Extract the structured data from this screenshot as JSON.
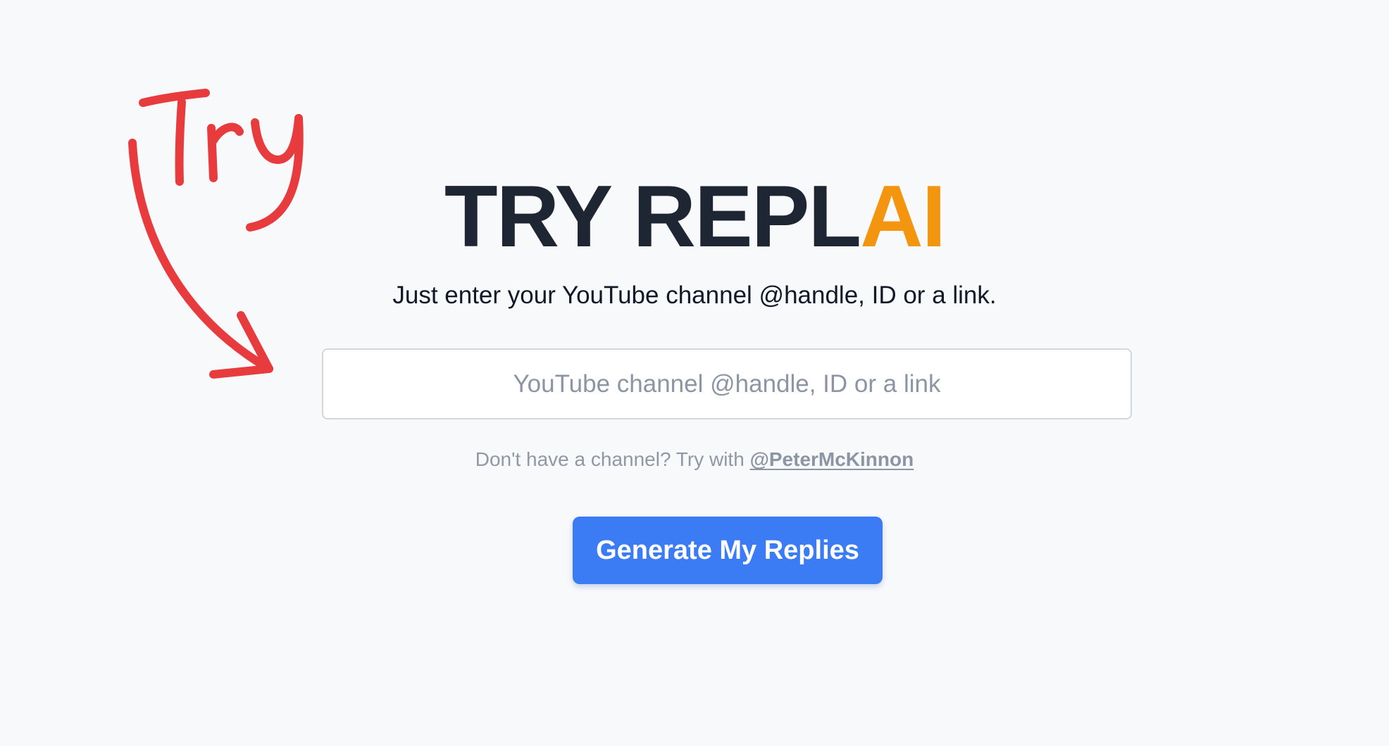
{
  "annotation": {
    "handwritten_text": "Try",
    "color": "#e83b3e"
  },
  "hero": {
    "title_main": "TRY REPL",
    "title_accent": "AI",
    "title_color": "#1e2633",
    "accent_color": "#f4950f",
    "subtitle": "Just enter your YouTube channel @handle, ID or a link."
  },
  "search": {
    "value": "",
    "placeholder": "YouTube channel @handle, ID or a link"
  },
  "hint": {
    "prefix": "Don't have a channel? Try with ",
    "link": "@PeterMcKinnon"
  },
  "actions": {
    "generate_label": "Generate My Replies",
    "generate_color": "#3b7cf5"
  }
}
